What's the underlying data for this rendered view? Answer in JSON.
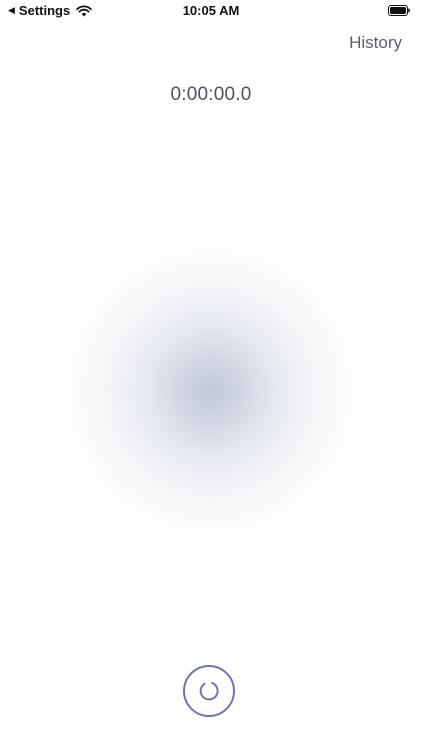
{
  "status_bar": {
    "back_label": "Settings",
    "time": "10:05 AM",
    "back_icon": "back-caret-icon",
    "wifi_icon": "wifi-icon",
    "battery_icon": "battery-icon"
  },
  "header": {
    "history_label": "History"
  },
  "timer": {
    "value": "0:00:00.0"
  },
  "record_button": {
    "icon": "spinner-icon"
  },
  "colors": {
    "accent": "#6f73b8",
    "timer_text": "#4f545b",
    "history_text": "#5b5f66",
    "blob": "#bec6d6"
  }
}
